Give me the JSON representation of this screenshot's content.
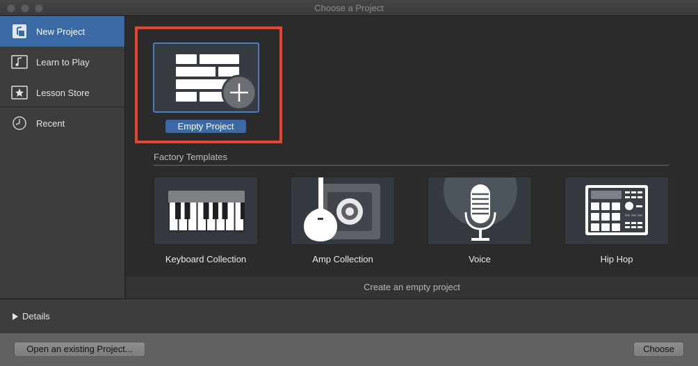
{
  "window": {
    "title": "Choose a Project"
  },
  "sidebar": {
    "items": [
      {
        "label": "New Project",
        "icon": "new-project-icon",
        "selected": true
      },
      {
        "label": "Learn to Play",
        "icon": "music-note-icon",
        "selected": false
      },
      {
        "label": "Lesson Store",
        "icon": "star-icon",
        "selected": false
      },
      {
        "label": "Recent",
        "icon": "clock-icon",
        "selected": false
      }
    ]
  },
  "main": {
    "empty_project": {
      "label": "Empty Project",
      "icon": "brick-plus-icon"
    },
    "section_title": "Factory Templates",
    "templates": [
      {
        "label": "Keyboard Collection",
        "icon": "piano-keys-icon"
      },
      {
        "label": "Amp Collection",
        "icon": "guitar-amp-icon"
      },
      {
        "label": "Voice",
        "icon": "microphone-icon"
      },
      {
        "label": "Hip Hop",
        "icon": "drum-machine-icon"
      }
    ],
    "status_text": "Create an empty project"
  },
  "details": {
    "label": "Details"
  },
  "buttons": {
    "open_existing": "Open an existing Project...",
    "choose": "Choose"
  },
  "colors": {
    "accent": "#3a6aa6",
    "highlight": "#e8452f"
  }
}
